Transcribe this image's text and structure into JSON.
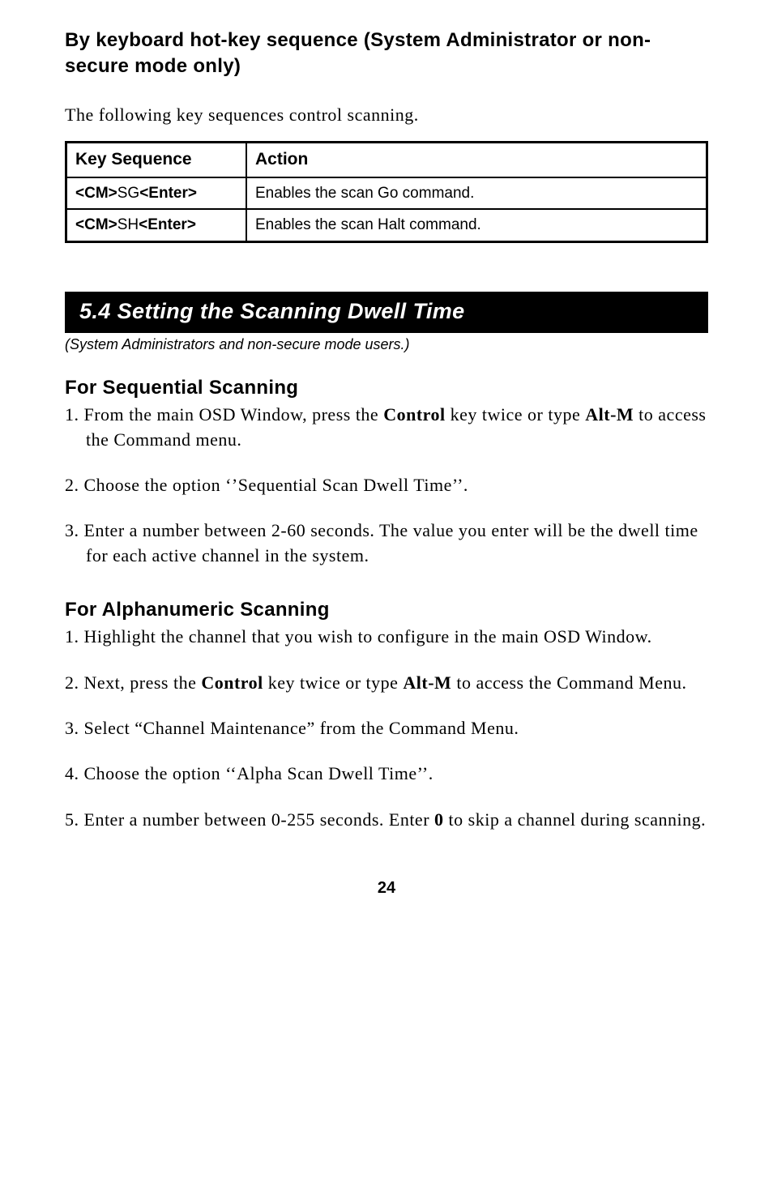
{
  "top_heading": "By keyboard hot-key sequence (System Administrator or non-secure mode only)",
  "intro_para": "The following key sequences control scanning.",
  "table": {
    "headers": [
      "Key Sequence",
      "Action"
    ],
    "rows": [
      {
        "seq_bold_pre": "<CM>",
        "seq_plain_mid": "SG",
        "seq_bold_post": "<Enter>",
        "action": "Enables the scan Go command."
      },
      {
        "seq_bold_pre": "<CM>",
        "seq_plain_mid": "SH",
        "seq_bold_post": "<Enter>",
        "action": "Enables the scan Halt command."
      }
    ]
  },
  "section_bar": "5.4  Setting the Scanning Dwell Time",
  "section_sub": "(System Administrators and non-secure mode users.)",
  "seq_head": "For Sequential Scanning",
  "seq_steps": [
    {
      "num": "1. ",
      "parts": [
        {
          "t": "From the main OSD Window, press the "
        },
        {
          "t": "Control",
          "b": true
        },
        {
          "t": " key twice or type "
        },
        {
          "t": "Alt-M",
          "b": true
        },
        {
          "t": " to access the Command menu."
        }
      ]
    },
    {
      "num": "2. ",
      "parts": [
        {
          "t": "Choose the option ‘’Sequential Scan Dwell Time’’."
        }
      ]
    },
    {
      "num": "3. ",
      "parts": [
        {
          "t": "Enter a number between 2-60 seconds. The value you enter will be the dwell time for each active channel in the system."
        }
      ]
    }
  ],
  "alpha_head": "For Alphanumeric Scanning",
  "alpha_steps": [
    {
      "num": "1. ",
      "parts": [
        {
          "t": "Highlight the channel that you wish to configure in the main OSD Window."
        }
      ]
    },
    {
      "num": "2. ",
      "parts": [
        {
          "t": "Next, press the "
        },
        {
          "t": "Control",
          "b": true
        },
        {
          "t": " key twice or type "
        },
        {
          "t": "Alt-M",
          "b": true
        },
        {
          "t": " to access the Command Menu."
        }
      ]
    },
    {
      "num": "3. ",
      "parts": [
        {
          "t": "Select “Channel Maintenance” from the Command Menu."
        }
      ]
    },
    {
      "num": "4. ",
      "parts": [
        {
          "t": "Choose the option ‘‘Alpha Scan Dwell Time’’."
        }
      ]
    },
    {
      "num": "5. ",
      "parts": [
        {
          "t": "Enter a number between 0-255 seconds. Enter "
        },
        {
          "t": "0",
          "b": true
        },
        {
          "t": " to skip a channel during scanning."
        }
      ]
    }
  ],
  "page_num": "24"
}
